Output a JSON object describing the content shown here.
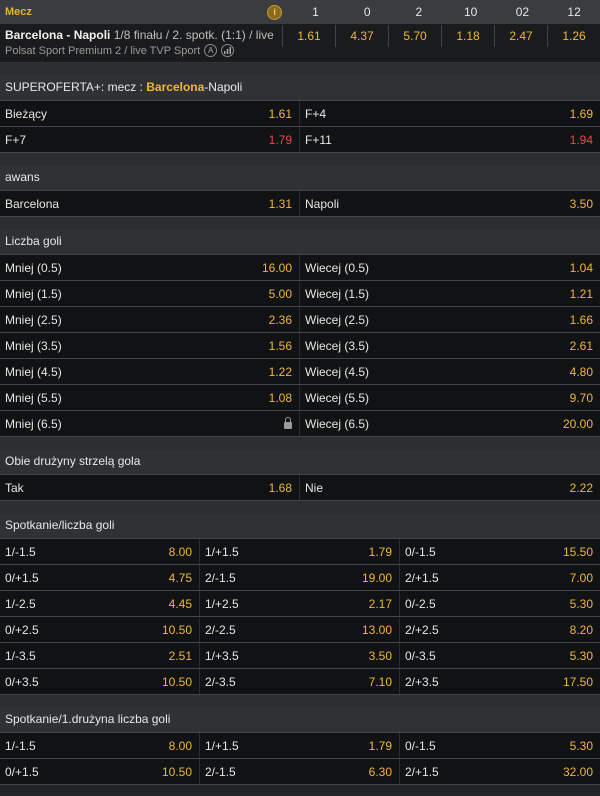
{
  "header": {
    "mecz": "Mecz",
    "info_icon": "info-icon",
    "cols": [
      "1",
      "0",
      "2",
      "10",
      "02",
      "12"
    ]
  },
  "match": {
    "teams": "Barcelona - Napoli",
    "meta": "1/8 finału / 2. spotk. (1:1) / live",
    "tv": "Polsat Sport Premium 2 / live TVP Sport",
    "icons": [
      "live-a-icon",
      "stats-icon"
    ],
    "a_glyph": "A",
    "odds": [
      "1.61",
      "4.37",
      "5.70",
      "1.18",
      "2.47",
      "1.26"
    ]
  },
  "superoferta": {
    "title_prefix": "SUPEROFERTA+: mecz : ",
    "home": "Barcelona",
    "rest": "-Napoli",
    "rows": [
      [
        {
          "label": "Bieżący",
          "value": "1.61"
        },
        {
          "label": "F+4",
          "value": "1.69"
        }
      ],
      [
        {
          "label": "F+7",
          "value": "1.79",
          "red": true
        },
        {
          "label": "F+11",
          "value": "1.94",
          "red": true
        }
      ]
    ]
  },
  "awans": {
    "title": "awans",
    "rows": [
      [
        {
          "label": "Barcelona",
          "value": "1.31"
        },
        {
          "label": "Napoli",
          "value": "3.50"
        }
      ]
    ]
  },
  "goals": {
    "title": "Liczba goli",
    "rows": [
      [
        {
          "label": "Mniej (0.5)",
          "value": "16.00"
        },
        {
          "label": "Wiecej (0.5)",
          "value": "1.04"
        }
      ],
      [
        {
          "label": "Mniej (1.5)",
          "value": "5.00"
        },
        {
          "label": "Wiecej (1.5)",
          "value": "1.21"
        }
      ],
      [
        {
          "label": "Mniej (2.5)",
          "value": "2.36"
        },
        {
          "label": "Wiecej (2.5)",
          "value": "1.66"
        }
      ],
      [
        {
          "label": "Mniej (3.5)",
          "value": "1.56"
        },
        {
          "label": "Wiecej (3.5)",
          "value": "2.61"
        }
      ],
      [
        {
          "label": "Mniej (4.5)",
          "value": "1.22"
        },
        {
          "label": "Wiecej (4.5)",
          "value": "4.80"
        }
      ],
      [
        {
          "label": "Mniej (5.5)",
          "value": "1.08"
        },
        {
          "label": "Wiecej (5.5)",
          "value": "9.70"
        }
      ],
      [
        {
          "label": "Mniej (6.5)",
          "value": "",
          "locked": true
        },
        {
          "label": "Wiecej (6.5)",
          "value": "20.00"
        }
      ]
    ]
  },
  "btts": {
    "title": "Obie drużyny strzelą gola",
    "rows": [
      [
        {
          "label": "Tak",
          "value": "1.68"
        },
        {
          "label": "Nie",
          "value": "2.22"
        }
      ]
    ]
  },
  "spotkanie": {
    "title": "Spotkanie/liczba goli",
    "rows": [
      [
        {
          "label": "1/-1.5",
          "value": "8.00"
        },
        {
          "label": "1/+1.5",
          "value": "1.79"
        },
        {
          "label": "0/-1.5",
          "value": "15.50"
        }
      ],
      [
        {
          "label": "0/+1.5",
          "value": "4.75"
        },
        {
          "label": "2/-1.5",
          "value": "19.00"
        },
        {
          "label": "2/+1.5",
          "value": "7.00"
        }
      ],
      [
        {
          "label": "1/-2.5",
          "value": "4.45"
        },
        {
          "label": "1/+2.5",
          "value": "2.17"
        },
        {
          "label": "0/-2.5",
          "value": "5.30"
        }
      ],
      [
        {
          "label": "0/+2.5",
          "value": "10.50"
        },
        {
          "label": "2/-2.5",
          "value": "13.00"
        },
        {
          "label": "2/+2.5",
          "value": "8.20"
        }
      ],
      [
        {
          "label": "1/-3.5",
          "value": "2.51"
        },
        {
          "label": "1/+3.5",
          "value": "3.50"
        },
        {
          "label": "0/-3.5",
          "value": "5.30"
        }
      ],
      [
        {
          "label": "0/+3.5",
          "value": "10.50"
        },
        {
          "label": "2/-3.5",
          "value": "7.10"
        },
        {
          "label": "2/+3.5",
          "value": "17.50"
        }
      ]
    ]
  },
  "spotkanie1": {
    "title": "Spotkanie/1.drużyna liczba goli",
    "rows": [
      [
        {
          "label": "1/-1.5",
          "value": "8.00"
        },
        {
          "label": "1/+1.5",
          "value": "1.79"
        },
        {
          "label": "0/-1.5",
          "value": "5.30"
        }
      ],
      [
        {
          "label": "0/+1.5",
          "value": "10.50"
        },
        {
          "label": "2/-1.5",
          "value": "6.30"
        },
        {
          "label": "2/+1.5",
          "value": "32.00"
        }
      ]
    ]
  },
  "colors": {
    "accent": "#f0b63a",
    "red": "#e84a4a",
    "row_bg": "#111213",
    "section_bg": "#2f3134"
  }
}
